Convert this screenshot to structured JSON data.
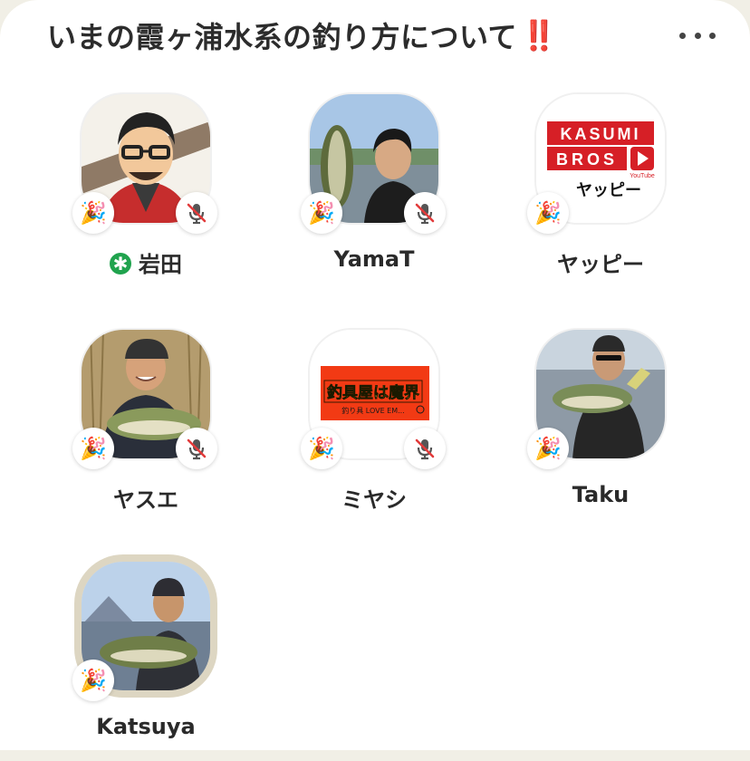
{
  "room": {
    "title": "いまの霞ヶ浦水系の釣り方について",
    "title_emoji": "‼️",
    "more_icon": "ellipsis-icon"
  },
  "speakers": [
    {
      "name": "岩田",
      "moderator": true,
      "muted": true,
      "reaction": "🎉"
    },
    {
      "name": "YamaT",
      "moderator": false,
      "muted": true,
      "reaction": "🎉"
    },
    {
      "name": "ヤッピー",
      "moderator": false,
      "muted": false,
      "reaction": "🎉",
      "avatar_text": {
        "row1": "KASUMI",
        "row2": "BROS",
        "sub": "YouTube",
        "tag": "ヤッピー"
      }
    },
    {
      "name": "ヤスエ",
      "moderator": false,
      "muted": true,
      "reaction": "🎉"
    },
    {
      "name": "ミヤシ",
      "moderator": false,
      "muted": true,
      "reaction": "🎉",
      "avatar_text": {
        "main": "釣具屋は魔界",
        "sub": "釣り具 LOVE EM..."
      }
    },
    {
      "name": "Taku",
      "moderator": false,
      "muted": false,
      "reaction": "🎉"
    },
    {
      "name": "Katsuya",
      "moderator": false,
      "muted": false,
      "speaking": true,
      "reaction": "🎉"
    }
  ],
  "colors": {
    "moderator_badge": "#20a34e",
    "mute_slash": "#e23b3b",
    "speaking_ring": "#ddd6c2",
    "kasumi_red": "#d61f26",
    "miyashi_red": "#f23a14",
    "miyashi_yellow": "#ffe24a"
  }
}
